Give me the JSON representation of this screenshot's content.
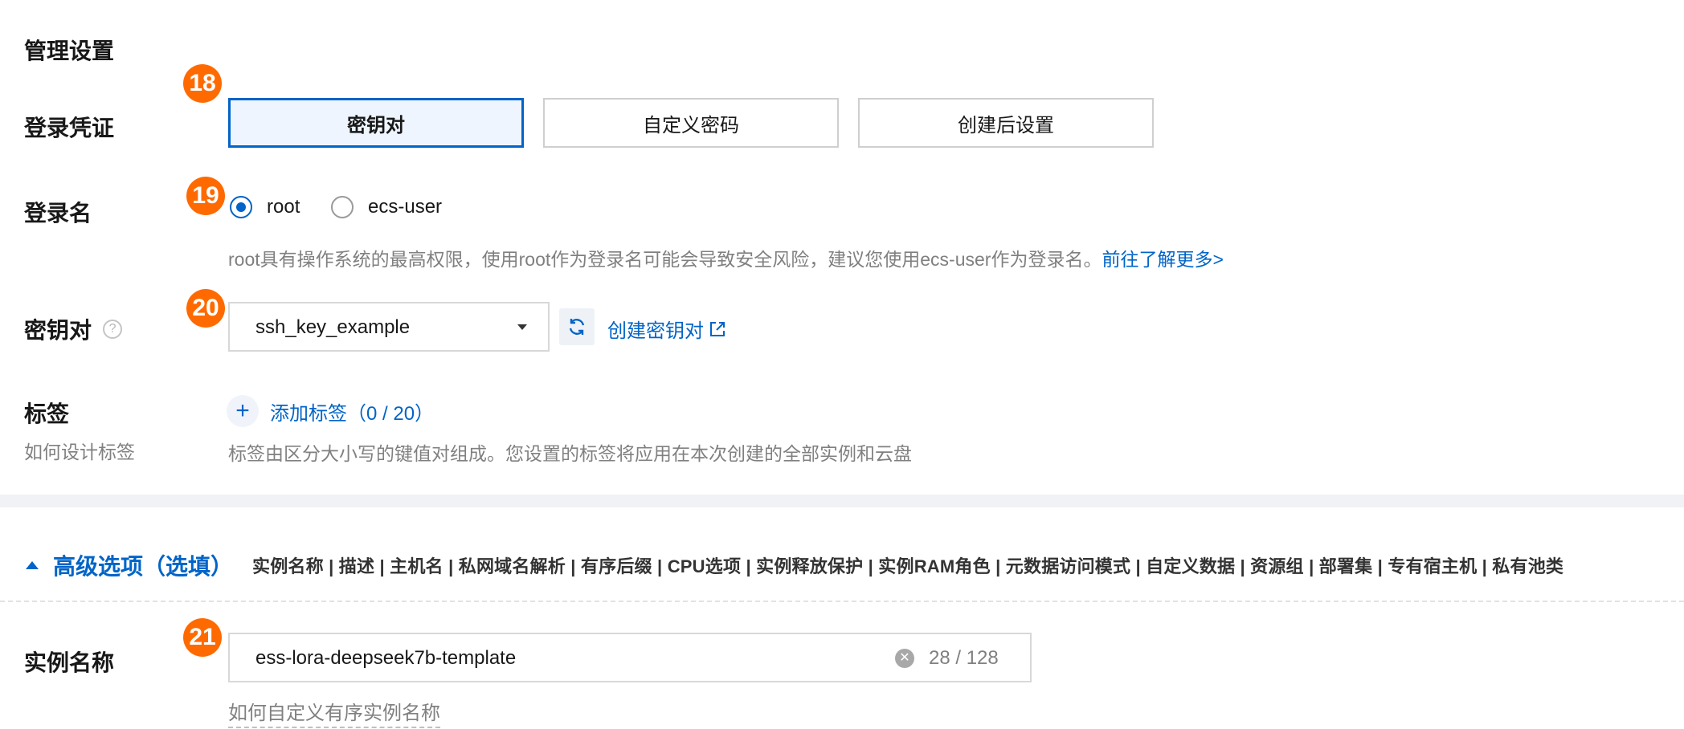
{
  "management": {
    "heading": "管理设置"
  },
  "badges": {
    "b18": "18",
    "b19": "19",
    "b20": "20",
    "b21": "21"
  },
  "login_credential": {
    "label": "登录凭证",
    "options": [
      "密钥对",
      "自定义密码",
      "创建后设置"
    ],
    "selected": "密钥对"
  },
  "login_name": {
    "label": "登录名",
    "options": [
      "root",
      "ecs-user"
    ],
    "selected": "root",
    "hint": "root具有操作系统的最高权限，使用root作为登录名可能会导致安全风险，建议您使用ecs-user作为登录名。",
    "learn_more": "前往了解更多>"
  },
  "key_pair": {
    "label": "密钥对",
    "help_icon": "question-circle-icon",
    "value": "ssh_key_example",
    "create_link": "创建密钥对"
  },
  "tags": {
    "label": "标签",
    "sub_link": "如何设计标签",
    "add_label": "添加标签（0 / 20）",
    "hint": "标签由区分大小写的键值对组成。您设置的标签将应用在本次创建的全部实例和云盘"
  },
  "advanced": {
    "title": "高级选项（选填）",
    "items": "实例名称 | 描述 | 主机名 | 私网域名解析 | 有序后缀 | CPU选项 | 实例释放保护 | 实例RAM角色 | 元数据访问模式 | 自定义数据 | 资源组 | 部署集 | 专有宿主机 | 私有池类"
  },
  "instance_name": {
    "label": "实例名称",
    "value": "ess-lora-deepseek7b-template",
    "counter": "28 / 128",
    "help_link": "如何自定义有序实例名称"
  },
  "colors": {
    "accent": "#0064c8",
    "badge": "#ff6a00",
    "hint": "#808080"
  }
}
